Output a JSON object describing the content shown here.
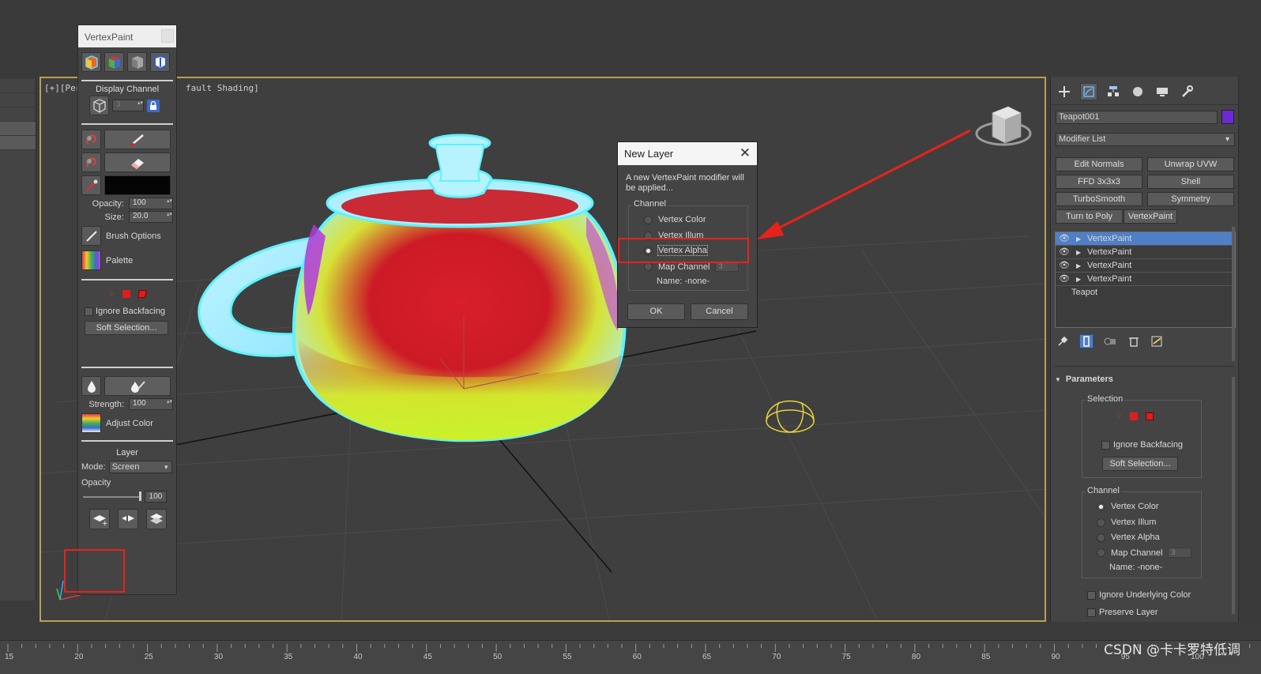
{
  "viewport": {
    "label_left": "[+][Pers",
    "label_right": "fault Shading]"
  },
  "vertexpaint_panel": {
    "title": "VertexPaint",
    "display_channel_label": "Display Channel",
    "display_channel_value": "3",
    "opacity_label": "Opacity:",
    "opacity_value": "100",
    "size_label": "Size:",
    "size_value": "20.0",
    "brush_options_label": "Brush Options",
    "palette_label": "Palette",
    "ignore_backfacing_label": "Ignore Backfacing",
    "soft_selection_label": "Soft Selection...",
    "strength_label": "Strength:",
    "strength_value": "100",
    "adjust_color_label": "Adjust Color",
    "layer_label": "Layer",
    "mode_label": "Mode:",
    "mode_value": "Screen",
    "layer_opacity_label": "Opacity",
    "layer_opacity_value": "100",
    "paint_color": "#050505"
  },
  "new_layer_dialog": {
    "title": "New Layer",
    "message_line1": "A new VertexPaint modifier will",
    "message_line2": "be applied...",
    "channel_label": "Channel",
    "options": [
      {
        "label": "Vertex Color",
        "selected": false
      },
      {
        "label": "Vertex Illum",
        "selected": false
      },
      {
        "label": "Vertex Alpha",
        "selected": true
      },
      {
        "label": "Map Channel",
        "selected": false
      }
    ],
    "map_channel_value": "3",
    "name_label": "Name: -none-",
    "ok_label": "OK",
    "cancel_label": "Cancel"
  },
  "command_panel": {
    "object_name": "Teapot001",
    "object_color": "#6b2ad3",
    "modifier_list_label": "Modifier List",
    "modifier_buttons": [
      "Edit Normals",
      "Unwrap UVW",
      "FFD 3x3x3",
      "Shell",
      "TurboSmooth",
      "Symmetry",
      "Turn to Poly",
      "VertexPaint"
    ],
    "stack": [
      {
        "label": "VertexPaint",
        "selected": true
      },
      {
        "label": "VertexPaint",
        "selected": false
      },
      {
        "label": "VertexPaint",
        "selected": false
      },
      {
        "label": "VertexPaint",
        "selected": false
      }
    ],
    "base_object": "Teapot",
    "parameters_label": "Parameters",
    "selection_label": "Selection",
    "ignore_backfacing_label": "Ignore Backfacing",
    "soft_selection_label": "Soft Selection...",
    "channel_label": "Channel",
    "channel_options": [
      {
        "label": "Vertex Color",
        "selected": true
      },
      {
        "label": "Vertex Illum",
        "selected": false
      },
      {
        "label": "Vertex Alpha",
        "selected": false
      },
      {
        "label": "Map Channel",
        "selected": false
      }
    ],
    "map_channel_value": "3",
    "name_label": "Name: -none-",
    "ignore_underlying_label": "Ignore Underlying Color",
    "preserve_layer_label": "Preserve Layer"
  },
  "timeline": {
    "ticks": [
      "15",
      "20",
      "25",
      "30",
      "35",
      "40",
      "45",
      "50",
      "55",
      "60",
      "65",
      "70",
      "75",
      "80",
      "85",
      "90",
      "95",
      "100"
    ]
  },
  "watermark": "CSDN @卡卡罗特低调",
  "colors": {
    "annotation_red": "#e8221b",
    "selection_blue": "#4e7fc7",
    "viewport_border": "#b9a050"
  }
}
